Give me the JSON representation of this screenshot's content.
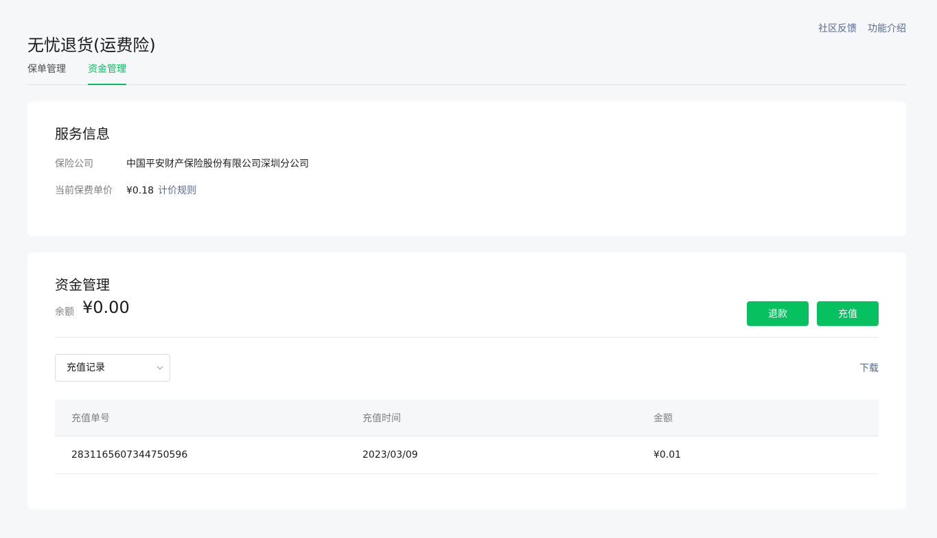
{
  "header": {
    "title": "无忧退货(运费险)",
    "links": [
      "社区反馈",
      "功能介绍"
    ]
  },
  "tabs": [
    {
      "label": "保单管理",
      "active": false
    },
    {
      "label": "资金管理",
      "active": true
    }
  ],
  "service": {
    "title": "服务信息",
    "company_label": "保险公司",
    "company_value": "中国平安财产保险股份有限公司深圳分公司",
    "price_label": "当前保费单价",
    "price_value": "¥0.18",
    "pricing_link": "计价规则"
  },
  "funds": {
    "title": "资金管理",
    "balance_label": "余额",
    "balance_value": "¥0.00",
    "refund_button": "退款",
    "recharge_button": "充值",
    "select_value": "充值记录",
    "download_link": "下载",
    "table": {
      "headers": [
        "充值单号",
        "充值时间",
        "金额"
      ],
      "rows": [
        [
          "2831165607344750596",
          "2023/03/09",
          "¥0.01"
        ]
      ]
    }
  },
  "colors": {
    "accent": "#07c160",
    "link": "#576b95",
    "background": "#f6f7f9"
  }
}
